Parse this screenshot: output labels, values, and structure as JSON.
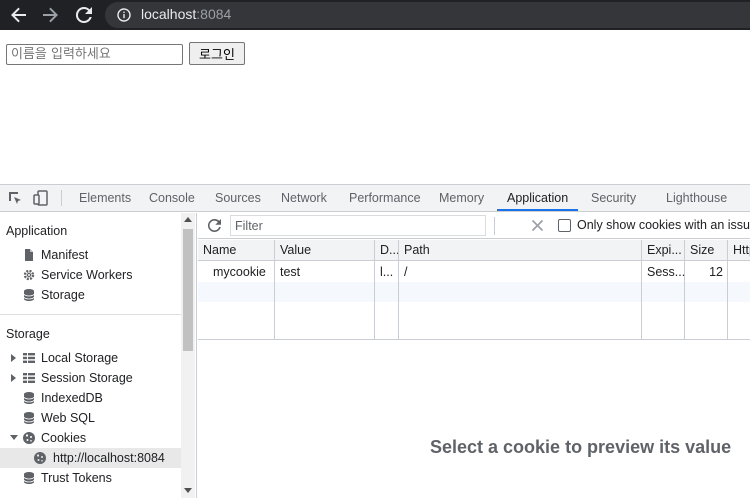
{
  "browser": {
    "url_host": "localhost",
    "url_port": ":8084"
  },
  "page": {
    "name_placeholder": "이름을 입력하세요",
    "login_label": "로그인"
  },
  "devtools": {
    "tabs": [
      "Elements",
      "Console",
      "Sources",
      "Network",
      "Performance",
      "Memory",
      "Application",
      "Security",
      "Lighthouse"
    ],
    "active_tab": "Application",
    "sidebar": {
      "application_title": "Application",
      "application_items": [
        "Manifest",
        "Service Workers",
        "Storage"
      ],
      "storage_title": "Storage",
      "storage_items": [
        "Local Storage",
        "Session Storage",
        "IndexedDB",
        "Web SQL",
        "Cookies",
        "http://localhost:8084",
        "Trust Tokens"
      ]
    },
    "toolbar": {
      "filter_placeholder": "Filter",
      "only_issues_label": "Only show cookies with an issue"
    },
    "table": {
      "headers": [
        "Name",
        "Value",
        "D...",
        "Path",
        "Expi...",
        "Size",
        "Http"
      ],
      "rows": [
        [
          "mycookie",
          "test",
          "l...",
          "/",
          "Sess...",
          "12"
        ]
      ]
    },
    "preview_message": "Select a cookie to preview its value"
  }
}
